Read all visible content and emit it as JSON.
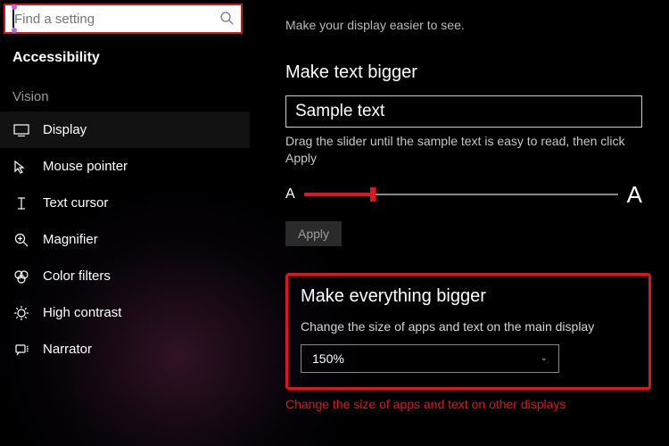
{
  "search": {
    "placeholder": "Find a setting"
  },
  "nav": {
    "title": "Accessibility",
    "category": "Vision",
    "items": [
      {
        "label": "Display"
      },
      {
        "label": "Mouse pointer"
      },
      {
        "label": "Text cursor"
      },
      {
        "label": "Magnifier"
      },
      {
        "label": "Color filters"
      },
      {
        "label": "High contrast"
      },
      {
        "label": "Narrator"
      }
    ]
  },
  "main": {
    "intro": "Make your display easier to see.",
    "text_section": {
      "title": "Make text bigger",
      "sample": "Sample text",
      "hint": "Drag the slider until the sample text is easy to read, then click Apply",
      "small_a": "A",
      "big_a": "A",
      "apply": "Apply"
    },
    "everything_section": {
      "title": "Make everything bigger",
      "desc": "Change the size of apps and text on the main display",
      "value": "150%"
    },
    "footer_link": "Change the size of apps and text on other displays"
  }
}
